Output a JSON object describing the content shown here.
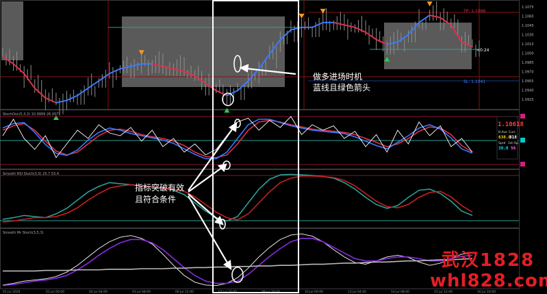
{
  "chart_data": [
    {
      "type": "line",
      "panel": "price",
      "header": "",
      "series": [
        {
          "name": "",
          "color": "#e0304a",
          "values": [
            1.0975,
            1.096,
            1.094,
            1.091,
            1.089,
            1.088,
            1.0885,
            1.0895,
            1.091,
            1.0925,
            1.094,
            1.095,
            1.0955,
            1.096,
            1.096,
            1.0955,
            1.095,
            1.0945,
            1.0935,
            1.092,
            1.0905,
            1.0895,
            1.0905,
            1.0925,
            1.095,
            1.098,
            1.101,
            1.103,
            1.1035,
            1.1035,
            1.1045,
            1.1045,
            1.104,
            1.1035,
            1.1025,
            1.101,
            1.1,
            1.1005,
            1.102,
            1.1045,
            1.106,
            1.1055,
            1.104,
            1.1005,
            1.0995
          ]
        }
      ],
      "right_labels": [
        "TP: 1.1068",
        "SL: 1.1041",
        "<0:24"
      ],
      "signals": {
        "up_arrow_color": "#2ecc40",
        "down_arrow_color": "#ff9922"
      }
    },
    {
      "type": "line",
      "panel": "osc1",
      "header": "StochOsc(5,3,3) 10.9999 26.0071",
      "ylim": [
        0,
        100
      ],
      "levels": [
        80,
        50,
        20
      ],
      "series": [
        {
          "name": "",
          "color": "#e0304a",
          "values": [
            70,
            78,
            82,
            70,
            50,
            32,
            25,
            30,
            45,
            60,
            70,
            72,
            68,
            62,
            58,
            55,
            50,
            42,
            30,
            22,
            20,
            25,
            45,
            70,
            85,
            88,
            85,
            80,
            76,
            72,
            70,
            68,
            66,
            62,
            55,
            48,
            40,
            45,
            55,
            68,
            76,
            74,
            62,
            42,
            30
          ]
        },
        {
          "name": "",
          "color": "#3a7bff",
          "values": [
            74,
            82,
            84,
            66,
            44,
            28,
            24,
            34,
            52,
            66,
            74,
            70,
            64,
            60,
            56,
            52,
            46,
            36,
            26,
            18,
            18,
            30,
            55,
            80,
            90,
            90,
            84,
            78,
            74,
            70,
            68,
            66,
            64,
            58,
            50,
            42,
            36,
            48,
            60,
            74,
            80,
            72,
            56,
            36,
            28
          ]
        },
        {
          "name": "",
          "color": "#ffffff",
          "values": [
            60,
            90,
            55,
            35,
            60,
            20,
            45,
            70,
            55,
            80,
            65,
            60,
            75,
            50,
            70,
            40,
            55,
            30,
            45,
            25,
            35,
            60,
            85,
            92,
            70,
            88,
            75,
            95,
            62,
            80,
            70,
            78,
            55,
            68,
            40,
            62,
            30,
            70,
            45,
            85,
            60,
            78,
            40,
            55,
            30
          ]
        }
      ],
      "side_panel": {
        "price": "1.10618",
        "fields": [
          {
            "label": "B.Ave",
            "value": "638.0"
          },
          {
            "label": "Curr.",
            "value": "318"
          },
          {
            "label": "Sprd",
            "value": "38.0"
          },
          {
            "label": "1st Op.",
            "value": "56"
          }
        ]
      }
    },
    {
      "type": "line",
      "panel": "osc2",
      "header": "Smooth RSI Stoch(3,5) 25.7 53.4",
      "ylim": [
        0,
        100
      ],
      "levels": [
        80,
        20
      ],
      "series": [
        {
          "name": "",
          "color": "#2aa198",
          "values": [
            15,
            18,
            22,
            20,
            18,
            25,
            35,
            50,
            65,
            75,
            82,
            80,
            78,
            76,
            74,
            72,
            68,
            60,
            45,
            30,
            18,
            12,
            20,
            45,
            70,
            88,
            96,
            97,
            96,
            95,
            93,
            90,
            82,
            70,
            55,
            42,
            35,
            40,
            55,
            68,
            70,
            62,
            48,
            30,
            22
          ]
        },
        {
          "name": "",
          "color": "#cc2020",
          "values": [
            10,
            12,
            15,
            18,
            18,
            20,
            26,
            36,
            50,
            62,
            72,
            76,
            78,
            76,
            74,
            72,
            70,
            66,
            56,
            42,
            28,
            18,
            14,
            25,
            45,
            65,
            82,
            90,
            94,
            94,
            93,
            91,
            86,
            76,
            62,
            48,
            38,
            36,
            42,
            55,
            64,
            66,
            56,
            40,
            28
          ]
        }
      ]
    },
    {
      "type": "line",
      "panel": "osc3",
      "header": "Smooth Mr Stoch(3,5,3)",
      "ylim": [
        0,
        100
      ],
      "series": [
        {
          "name": "",
          "color": "#ffffff",
          "values": [
            5,
            8,
            12,
            14,
            16,
            20,
            28,
            40,
            55,
            70,
            82,
            90,
            93,
            88,
            78,
            60,
            40,
            22,
            10,
            5,
            4,
            8,
            18,
            35,
            55,
            72,
            86,
            94,
            96,
            92,
            82,
            68,
            55,
            45,
            42,
            48,
            55,
            58,
            54,
            46,
            40,
            44,
            52,
            60,
            62
          ]
        },
        {
          "name": "",
          "color": "#8a2be2",
          "values": [
            4,
            6,
            9,
            12,
            14,
            17,
            22,
            32,
            44,
            58,
            70,
            80,
            86,
            86,
            80,
            68,
            52,
            36,
            22,
            12,
            8,
            8,
            12,
            24,
            40,
            56,
            70,
            82,
            88,
            88,
            82,
            72,
            62,
            52,
            48,
            48,
            52,
            55,
            55,
            52,
            48,
            48,
            52,
            56,
            58
          ]
        },
        {
          "name": "",
          "color": "#bbbbbb",
          "values": [
            30,
            30,
            30,
            30,
            31,
            31,
            31,
            32,
            32,
            32,
            33,
            33,
            33,
            34,
            34,
            34,
            35,
            35,
            36,
            36,
            37,
            37,
            38,
            38,
            39,
            39,
            40,
            40,
            41,
            42,
            42,
            43,
            44,
            44,
            45,
            46,
            46,
            47,
            48,
            48,
            49,
            50,
            50,
            51,
            52
          ]
        }
      ]
    }
  ],
  "annotations": {
    "entry_line1": "做多进场时机",
    "entry_line2": "蓝线且绿色箭头",
    "cross_line1": "指标突破有效",
    "cross_line2": "且符合条件"
  },
  "time_axis": [
    "01 Jul 2020",
    "01 Jul 00:00",
    "02 Jul 04:00",
    "03 Jul 08:00",
    "06 Jul 12:00",
    "07 Jul 16:00",
    "08 Jul 20:00",
    "10 Jul 00:00",
    "13 Jul 04:00",
    "14 Jul 08:00",
    "15 Jul 12:00",
    "16 Jul 16:00"
  ],
  "price_axis": [
    "1.1075",
    "1.1060",
    "1.1045",
    "1.1030",
    "1.1015",
    "1.1000",
    "1.0985",
    "1.0970",
    "1.0955",
    "1.0940",
    "1.0925"
  ],
  "watermark": {
    "line1": "武汉1828",
    "line2": "whl828.com"
  }
}
